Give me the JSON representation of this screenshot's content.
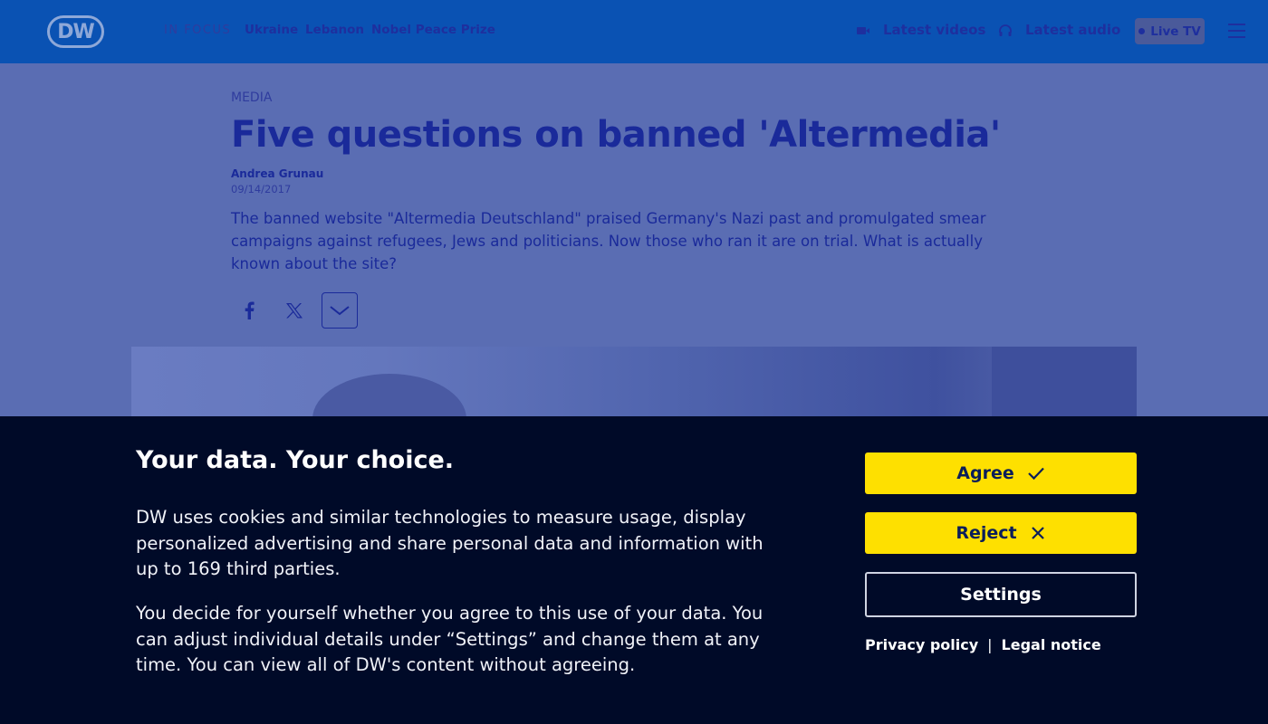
{
  "header": {
    "logo_text": "DW",
    "in_focus_label": "IN FOCUS",
    "focus_links": [
      "Ukraine",
      "Lebanon",
      "Nobel Peace Prize"
    ],
    "latest_videos": "Latest videos",
    "latest_audio": "Latest audio",
    "live_tv": "Live TV"
  },
  "article": {
    "kicker": "MEDIA",
    "title": "Five questions on banned 'Altermedia'",
    "author": "Andrea Grunau",
    "date": "09/14/2017",
    "teaser": "The banned website \"Altermedia Deutschland\" praised Germany's Nazi past and promulgated smear campaigns against refugees, Jews and politicians. Now those who ran it are on trial. What is actually known about the site?",
    "share_icons": [
      "facebook-icon",
      "x-icon",
      "chevron-down-icon"
    ]
  },
  "consent": {
    "title": "Your data. Your choice.",
    "paragraph1": "DW uses cookies and similar technologies to measure usage, display personalized advertising and share personal data and information with up to 169 third parties.",
    "paragraph2": "You decide for yourself whether you agree to this use of your data. You can adjust individual details under “Settings” and change them at any time. You can view all of DW's content without agreeing.",
    "agree_label": "Agree",
    "reject_label": "Reject",
    "settings_label": "Settings",
    "privacy_label": "Privacy policy",
    "separator": "|",
    "legal_label": "Legal notice"
  },
  "colors": {
    "header_bg": "#0a52b3",
    "page_overlay": "#5a6db3",
    "consent_bg": "#000a28",
    "button_yellow": "#fee000"
  }
}
